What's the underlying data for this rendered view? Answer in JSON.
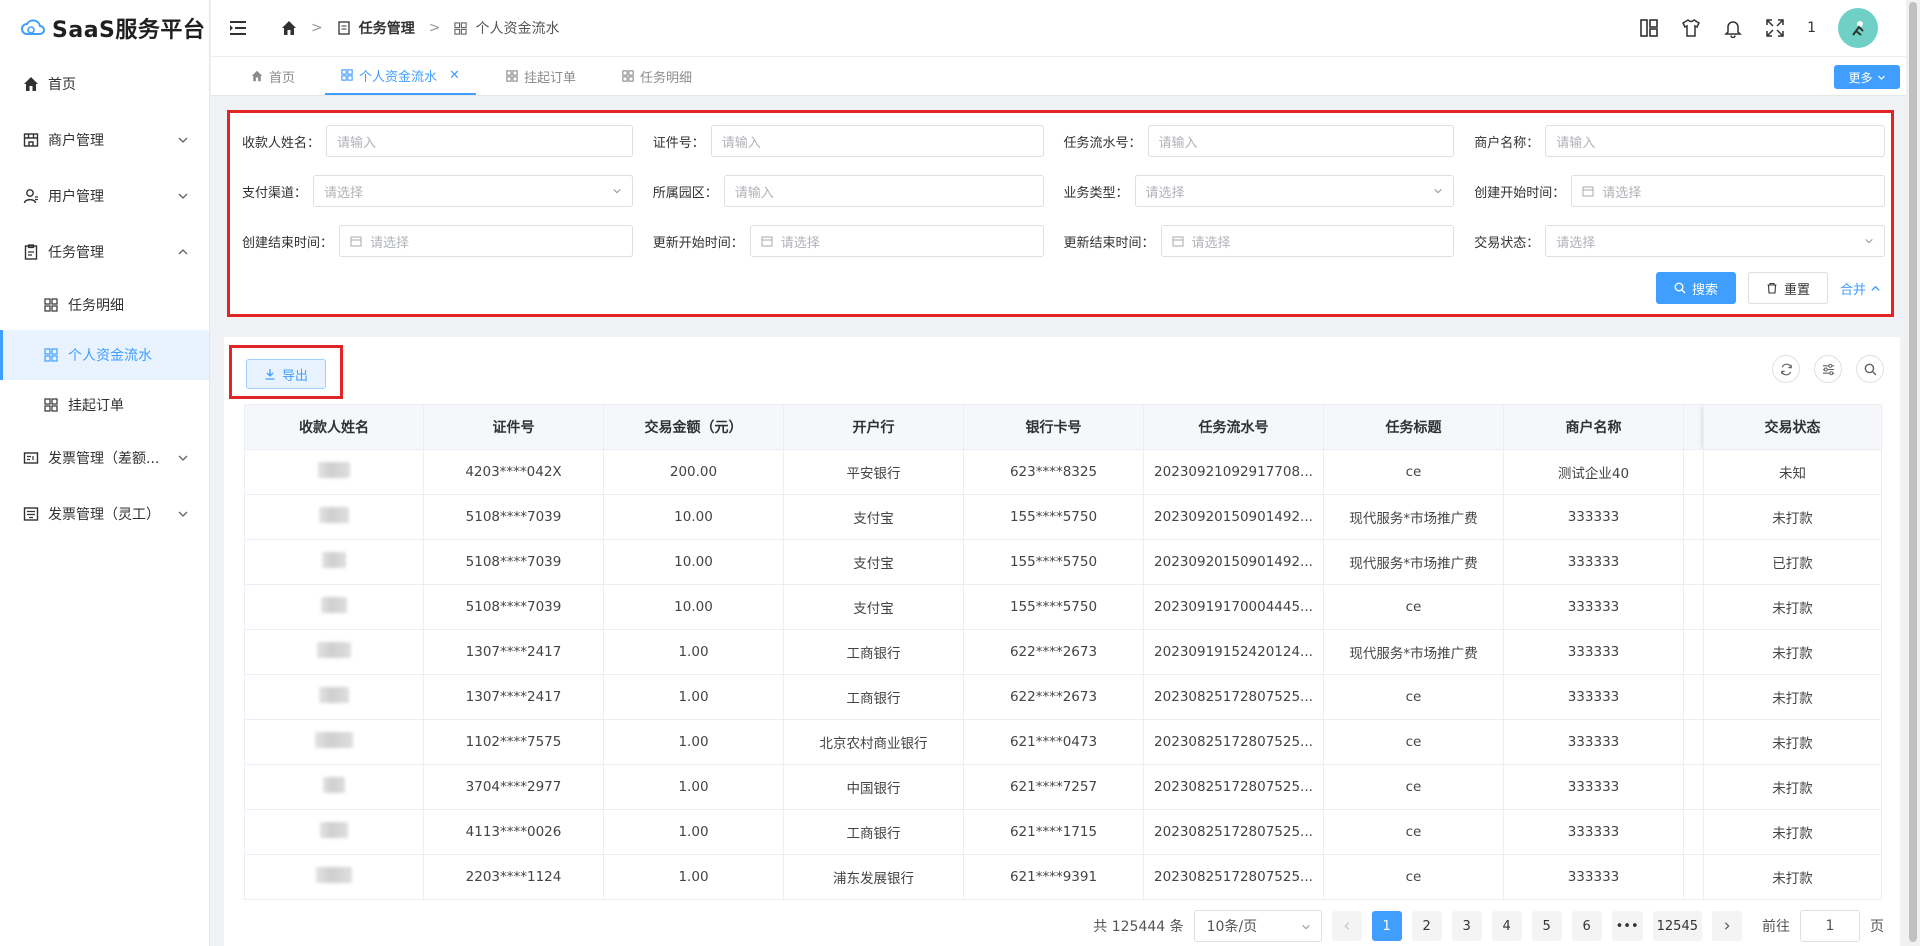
{
  "app": {
    "title": "SaaS服务平台"
  },
  "sidebar": {
    "items": [
      {
        "label": "首页"
      },
      {
        "label": "商户管理"
      },
      {
        "label": "用户管理"
      },
      {
        "label": "任务管理"
      },
      {
        "label": "发票管理（差额..."
      },
      {
        "label": "发票管理（灵工）"
      }
    ],
    "sub_items": [
      {
        "label": "任务明细"
      },
      {
        "label": "个人资金流水"
      },
      {
        "label": "挂起订单"
      }
    ]
  },
  "header": {
    "breadcrumb": [
      "任务管理",
      "个人资金流水"
    ],
    "notify_count": "1"
  },
  "tabs": [
    {
      "label": "首页"
    },
    {
      "label": "个人资金流水"
    },
    {
      "label": "挂起订单"
    },
    {
      "label": "任务明细"
    }
  ],
  "more_label": "更多",
  "filters": {
    "payee_name": {
      "label": "收款人姓名：",
      "placeholder": "请输入"
    },
    "id_no": {
      "label": "证件号：",
      "placeholder": "请输入"
    },
    "task_serial": {
      "label": "任务流水号：",
      "placeholder": "请输入"
    },
    "merchant": {
      "label": "商户名称：",
      "placeholder": "请输入"
    },
    "pay_channel": {
      "label": "支付渠道：",
      "placeholder": "请选择"
    },
    "park": {
      "label": "所属园区：",
      "placeholder": "请输入"
    },
    "biz_type": {
      "label": "业务类型：",
      "placeholder": "请选择"
    },
    "create_start": {
      "label": "创建开始时间：",
      "placeholder": "请选择"
    },
    "create_end": {
      "label": "创建结束时间：",
      "placeholder": "请选择"
    },
    "update_start": {
      "label": "更新开始时间：",
      "placeholder": "请选择"
    },
    "update_end": {
      "label": "更新结束时间：",
      "placeholder": "请选择"
    },
    "trade_status": {
      "label": "交易状态：",
      "placeholder": "请选择"
    },
    "search_label": "搜索",
    "reset_label": "重置",
    "collapse_label": "合并"
  },
  "toolbar": {
    "export_label": "导出"
  },
  "table": {
    "columns": [
      "收款人姓名",
      "证件号",
      "交易金额（元）",
      "开户行",
      "银行卡号",
      "任务流水号",
      "任务标题",
      "商户名称",
      "",
      "交易状态"
    ],
    "rows": [
      [
        "4203****042X",
        "200.00",
        "平安银行",
        "623****8325",
        "20230921092917708...",
        "ce",
        "测试企业40",
        "未知"
      ],
      [
        "5108****7039",
        "10.00",
        "支付宝",
        "155****5750",
        "20230920150901492...",
        "现代服务*市场推广费",
        "333333",
        "未打款"
      ],
      [
        "5108****7039",
        "10.00",
        "支付宝",
        "155****5750",
        "20230920150901492...",
        "现代服务*市场推广费",
        "333333",
        "已打款"
      ],
      [
        "5108****7039",
        "10.00",
        "支付宝",
        "155****5750",
        "20230919170004445...",
        "ce",
        "333333",
        "未打款"
      ],
      [
        "1307****2417",
        "1.00",
        "工商银行",
        "622****2673",
        "20230919152420124...",
        "现代服务*市场推广费",
        "333333",
        "未打款"
      ],
      [
        "1307****2417",
        "1.00",
        "工商银行",
        "622****2673",
        "20230825172807525...",
        "ce",
        "333333",
        "未打款"
      ],
      [
        "1102****7575",
        "1.00",
        "北京农村商业银行",
        "621****0473",
        "20230825172807525...",
        "ce",
        "333333",
        "未打款"
      ],
      [
        "3704****2977",
        "1.00",
        "中国银行",
        "621****7257",
        "20230825172807525...",
        "ce",
        "333333",
        "未打款"
      ],
      [
        "4113****0026",
        "1.00",
        "工商银行",
        "621****1715",
        "20230825172807525...",
        "ce",
        "333333",
        "未打款"
      ],
      [
        "2203****1124",
        "1.00",
        "浦东发展银行",
        "621****9391",
        "20230825172807525...",
        "ce",
        "333333",
        "未打款"
      ]
    ]
  },
  "pagination": {
    "total_text": "共 125444 条",
    "page_size": "10条/页",
    "pages": [
      "1",
      "2",
      "3",
      "4",
      "5",
      "6",
      "•••",
      "12545"
    ],
    "current": "1",
    "goto_label": "前往",
    "goto_value": "1",
    "page_unit": "页"
  },
  "colors": {
    "primary": "#409eff",
    "highlight_border": "#e32424"
  }
}
